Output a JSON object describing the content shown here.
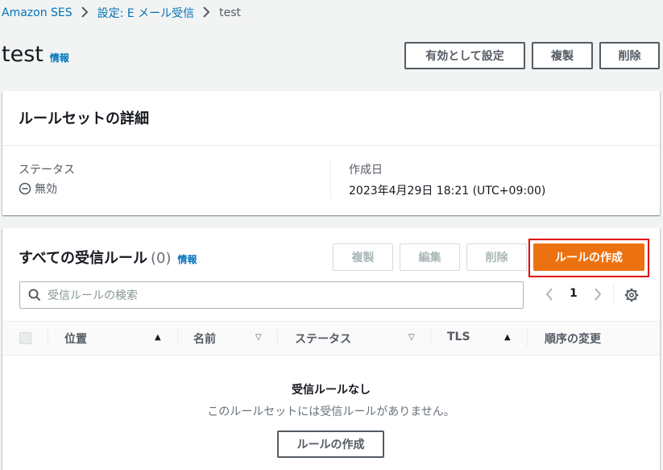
{
  "breadcrumb": {
    "items": [
      "Amazon SES",
      "設定: E メール受信"
    ],
    "current": "test"
  },
  "page": {
    "title": "test",
    "info_link": "情報",
    "actions": {
      "set_active": "有効として設定",
      "duplicate": "複製",
      "delete": "削除"
    }
  },
  "details": {
    "header": "ルールセットの詳細",
    "status_label": "ステータス",
    "status_value": "無効",
    "created_label": "作成日",
    "created_value": "2023年4月29日 18:21 (UTC+09:00)"
  },
  "rules": {
    "header": "すべての受信ルール",
    "count": "(0)",
    "info_link": "情報",
    "actions": {
      "duplicate": "複製",
      "edit": "編集",
      "delete": "削除",
      "create": "ルールの作成"
    },
    "search_placeholder": "受信ルールの検索",
    "pagination": {
      "current_page": "1"
    },
    "columns": [
      "位置",
      "名前",
      "ステータス",
      "TLS",
      "順序の変更"
    ],
    "empty": {
      "title": "受信ルールなし",
      "message": "このルールセットには受信ルールがありません。",
      "create_button": "ルールの作成"
    }
  },
  "colors": {
    "link": "#0073bb",
    "primary": "#ec7211",
    "highlight": "#e00000"
  }
}
